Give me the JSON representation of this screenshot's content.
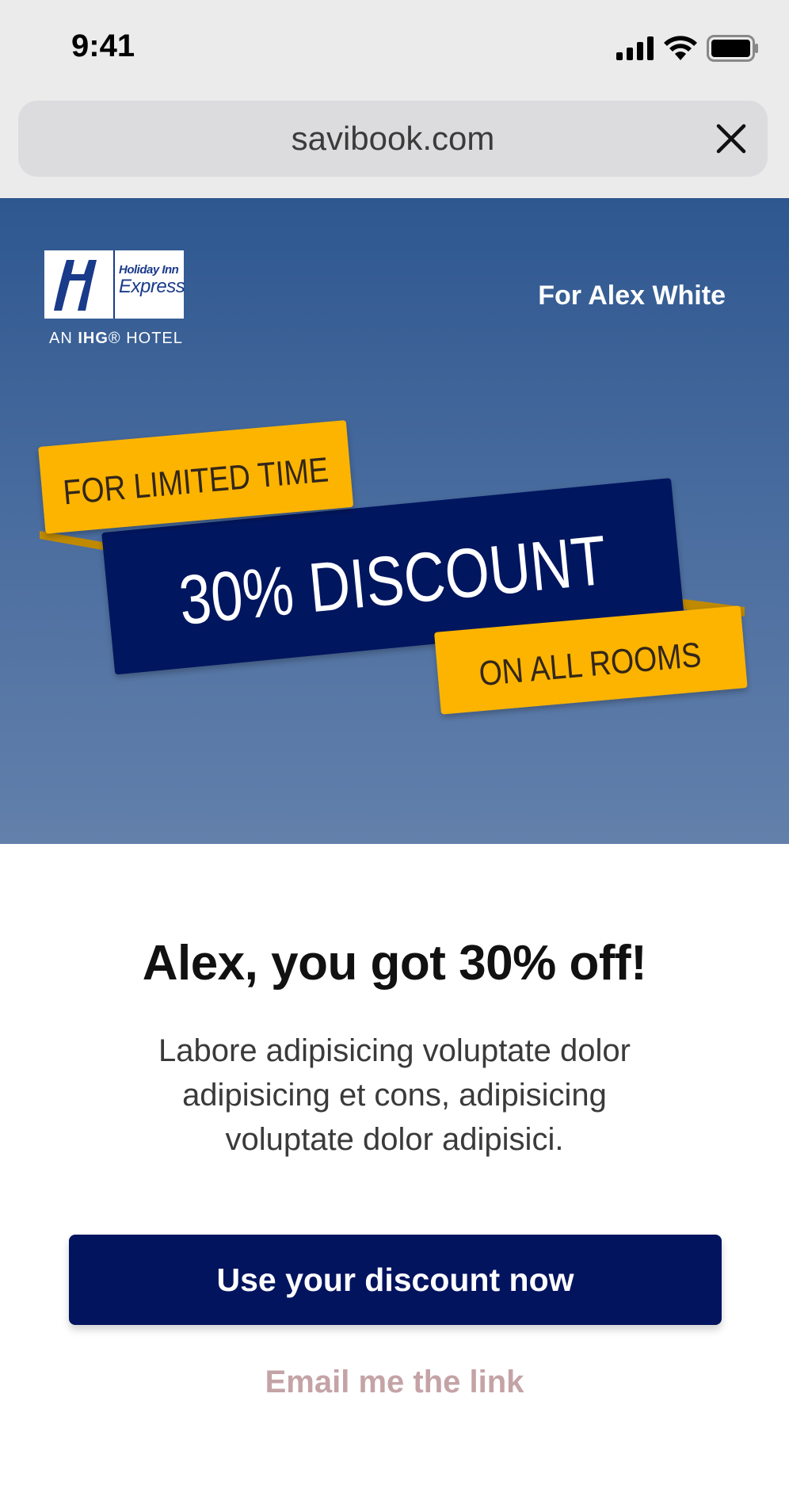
{
  "status_bar": {
    "time": "9:41"
  },
  "browser": {
    "url": "savibook.com",
    "close_icon": "close-icon"
  },
  "hero": {
    "logo": {
      "line1": "Holiday Inn",
      "line2": "Express",
      "sub_prefix": "AN ",
      "sub_brand": "IHG",
      "sub_suffix": "® HOTEL"
    },
    "recipient": "For Alex White",
    "banner": {
      "top_ribbon": "FOR LIMITED TIME",
      "main": "30% DISCOUNT",
      "bottom_ribbon": "ON ALL ROOMS"
    },
    "colors": {
      "gold": "#fcb400",
      "navy": "#03145f"
    }
  },
  "content": {
    "headline": "Alex, you got 30% off!",
    "body": "Labore adipisicing voluptate dolor adipisicing et cons, adipisicing voluptate dolor adipisici.",
    "cta_label": "Use your discount now",
    "link_label": "Email me the link"
  }
}
